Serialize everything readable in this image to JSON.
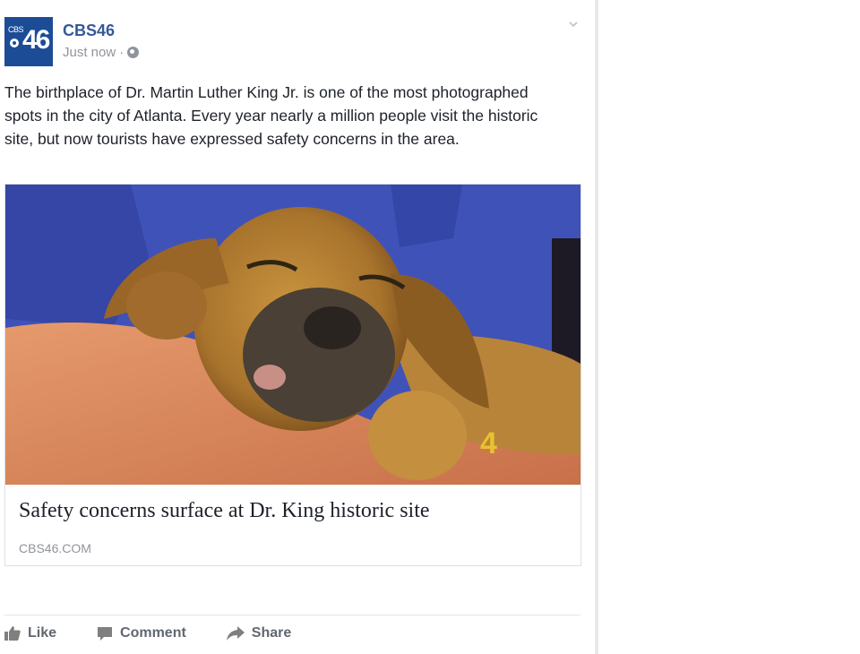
{
  "post": {
    "page_name": "CBS46",
    "timestamp": "Just now",
    "separator": "·",
    "avatar": {
      "small_text": "CBS",
      "number": "46"
    },
    "privacy_icon": "globe-icon",
    "options_icon": "chevron-down-icon",
    "text": "The birthplace of Dr. Martin Luther King Jr. is one of the most photographed spots in the city of Atlanta. Every year nearly a million people visit the historic site, but now tourists have expressed safety concerns in the area."
  },
  "link_card": {
    "image_icon": "sleeping-puppy-photo",
    "title": "Safety concerns surface at Dr. King historic site",
    "domain": "CBS46.COM"
  },
  "actions": [
    {
      "label": "Like",
      "icon": "thumbs-up-icon"
    },
    {
      "label": "Comment",
      "icon": "comment-icon"
    },
    {
      "label": "Share",
      "icon": "share-icon"
    }
  ],
  "colors": {
    "brand_blue": "#365899",
    "meta_gray": "#90949c",
    "action_gray": "#616770"
  }
}
